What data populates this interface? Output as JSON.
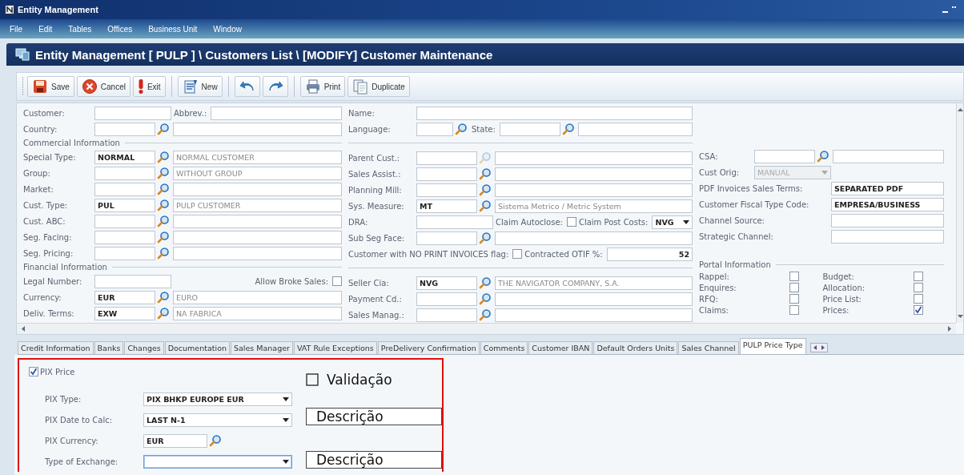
{
  "window": {
    "title": "Entity Management"
  },
  "menu": [
    "File",
    "Edit",
    "Tables",
    "Offices",
    "Business Unit",
    "Window"
  ],
  "page_title": "Entity Management [ PULP ] \\ Customers List \\ [MODIFY] Customer Maintenance",
  "toolbar": [
    {
      "buttons": [
        {
          "kind": "save",
          "label": "Save"
        },
        {
          "kind": "cancel",
          "label": "Cancel"
        },
        {
          "kind": "exit",
          "label": "Exit"
        }
      ]
    },
    {
      "buttons": [
        {
          "kind": "new",
          "label": "New"
        }
      ]
    },
    {
      "buttons": [
        {
          "kind": "undo"
        },
        {
          "kind": "redo"
        }
      ]
    },
    {
      "buttons": [
        {
          "kind": "print",
          "label": "Print"
        },
        {
          "kind": "duplicate",
          "label": "Duplicate"
        }
      ]
    }
  ],
  "form": {
    "columns": [
      {
        "items": [
          {
            "kind": "row",
            "fields": [
              {
                "kind": "text",
                "label": "Customer:"
              },
              {
                "kind": "text",
                "label": "Abbrev.:"
              }
            ]
          },
          {
            "kind": "row",
            "fields": [
              {
                "kind": "lookup_desc",
                "label": "Country:"
              }
            ]
          },
          {
            "kind": "section",
            "title": "Commercial Information"
          },
          {
            "kind": "row",
            "fields": [
              {
                "kind": "lookup_desc",
                "label": "Special Type:",
                "code": "NORMAL",
                "description": "NORMAL CUSTOMER"
              }
            ]
          },
          {
            "kind": "row",
            "fields": [
              {
                "kind": "lookup_desc",
                "label": "Group:",
                "description": "WITHOUT GROUP"
              }
            ]
          },
          {
            "kind": "row",
            "fields": [
              {
                "kind": "lookup_desc",
                "label": "Market:"
              }
            ]
          },
          {
            "kind": "row",
            "fields": [
              {
                "kind": "lookup_desc",
                "label": "Cust. Type:",
                "code": "PUL",
                "description": "PULP CUSTOMER"
              }
            ]
          },
          {
            "kind": "row",
            "fields": [
              {
                "kind": "lookup_desc",
                "label": "Cust. ABC:"
              }
            ]
          },
          {
            "kind": "row",
            "fields": [
              {
                "kind": "lookup_desc",
                "label": "Seg. Facing:"
              }
            ]
          },
          {
            "kind": "row",
            "fields": [
              {
                "kind": "lookup_desc",
                "label": "Seg. Pricing:"
              }
            ]
          },
          {
            "kind": "section",
            "title": "Financial Information"
          },
          {
            "kind": "row",
            "fields": [
              {
                "kind": "text",
                "label": "Legal Number:"
              },
              {
                "kind": "check",
                "label": "Allow Broke Sales:",
                "checked": false
              }
            ]
          },
          {
            "kind": "row",
            "fields": [
              {
                "kind": "lookup_desc",
                "label": "Currency:",
                "code": "EUR",
                "description": "EURO"
              }
            ]
          },
          {
            "kind": "row",
            "fields": [
              {
                "kind": "lookup_desc",
                "label": "Deliv. Terms:",
                "code": "EXW",
                "description": "NA FABRICA"
              }
            ]
          }
        ]
      },
      {
        "items": [
          {
            "kind": "row",
            "fields": [
              {
                "kind": "text",
                "label": "Name:"
              }
            ]
          },
          {
            "kind": "row",
            "fields": [
              {
                "kind": "lookup",
                "label": "Language:"
              },
              {
                "kind": "lookup_desc",
                "label": "State:"
              }
            ]
          },
          {
            "kind": "rule"
          },
          {
            "kind": "row",
            "fields": [
              {
                "kind": "lookup_desc",
                "label": "Parent Cust.:",
                "disabled": true
              }
            ]
          },
          {
            "kind": "row",
            "fields": [
              {
                "kind": "lookup_desc",
                "label": "Sales Assist.:"
              }
            ]
          },
          {
            "kind": "row",
            "fields": [
              {
                "kind": "lookup_desc",
                "label": "Planning Mill:"
              }
            ]
          },
          {
            "kind": "row",
            "fields": [
              {
                "kind": "lookup_desc",
                "label": "Sys. Measure:",
                "code": "MT",
                "description": "Sistema Metrico / Metric System"
              }
            ]
          },
          {
            "kind": "row",
            "fields": [
              {
                "kind": "text",
                "label": "DRA:"
              },
              {
                "kind": "check",
                "label": "Claim Autoclose:",
                "checked": false
              },
              {
                "kind": "combo",
                "label": "Claim Post Costs:",
                "value": "NVG"
              }
            ]
          },
          {
            "kind": "row",
            "fields": [
              {
                "kind": "lookup_desc",
                "label": "Sub Seg Face:"
              }
            ]
          },
          {
            "kind": "row",
            "fields": [
              {
                "kind": "check",
                "label": "Customer with NO PRINT INVOICES flag:",
                "checked": false
              },
              {
                "kind": "number",
                "label": "Contracted OTIF %:",
                "value": "52"
              }
            ]
          },
          {
            "kind": "rule"
          },
          {
            "kind": "row",
            "fields": [
              {
                "kind": "lookup_desc",
                "label": "Seller Cia:",
                "code": "NVG",
                "description": "THE NAVIGATOR COMPANY, S.A."
              }
            ]
          },
          {
            "kind": "row",
            "fields": [
              {
                "kind": "lookup_desc",
                "label": "Payment Cd.:"
              }
            ]
          },
          {
            "kind": "row",
            "fields": [
              {
                "kind": "lookup_desc",
                "label": "Sales Manag.:"
              }
            ]
          }
        ]
      },
      {
        "items": [
          {
            "kind": "row",
            "fields": [
              {
                "kind": "lookup_desc",
                "label": "CSA:"
              }
            ]
          },
          {
            "kind": "row",
            "fields": [
              {
                "kind": "combo",
                "label": "Cust Orig:",
                "value": "MANUAL",
                "disabled": true
              }
            ]
          },
          {
            "kind": "row",
            "fields": [
              {
                "kind": "text",
                "label": "PDF Invoices Sales Terms:",
                "value": "SEPARATED PDF"
              }
            ]
          },
          {
            "kind": "row",
            "fields": [
              {
                "kind": "text",
                "label": "Customer Fiscal Type Code:",
                "value": "EMPRESA/BUSINESS"
              }
            ]
          },
          {
            "kind": "row",
            "fields": [
              {
                "kind": "text",
                "label": "Channel Source:"
              }
            ]
          },
          {
            "kind": "row",
            "fields": [
              {
                "kind": "text",
                "label": "Strategic Channel:"
              }
            ]
          },
          {
            "kind": "section",
            "title": "Portal Information"
          },
          {
            "kind": "compact_row",
            "fields": [
              {
                "kind": "check",
                "label": "Rappel:",
                "checked": false
              },
              {
                "kind": "check",
                "label": "Budget:",
                "checked": false
              }
            ]
          },
          {
            "kind": "compact_row",
            "fields": [
              {
                "kind": "check",
                "label": "Enquires:",
                "checked": false
              },
              {
                "kind": "check",
                "label": "Allocation:",
                "checked": false
              }
            ]
          },
          {
            "kind": "compact_row",
            "fields": [
              {
                "kind": "check",
                "label": "RFQ:",
                "checked": false
              },
              {
                "kind": "check",
                "label": "Price List:",
                "checked": false
              }
            ]
          },
          {
            "kind": "compact_row",
            "fields": [
              {
                "kind": "check",
                "label": "Claims:",
                "checked": false
              },
              {
                "kind": "check",
                "label": "Prices:",
                "checked": true
              }
            ]
          }
        ]
      }
    ]
  },
  "tabs": [
    {
      "label": "Credit Information",
      "selected": false
    },
    {
      "label": "Banks",
      "selected": false
    },
    {
      "label": "Changes",
      "selected": false
    },
    {
      "label": "Documentation",
      "selected": false
    },
    {
      "label": "Sales Manager",
      "selected": false
    },
    {
      "label": "VAT Rule Exceptions",
      "selected": false
    },
    {
      "label": "PreDelivery Confirmation",
      "selected": false
    },
    {
      "label": "Comments",
      "selected": false
    },
    {
      "label": "Customer IBAN",
      "selected": false
    },
    {
      "label": "Default Orders Units",
      "selected": false
    },
    {
      "label": "Sales Channel",
      "selected": false
    },
    {
      "label": "PULP Price Type",
      "selected": true
    }
  ],
  "pulp_price": {
    "pix_price": {
      "label": "PIX Price",
      "checked": true
    },
    "fields": [
      {
        "kind": "combo",
        "label": "PIX Type:",
        "value": "PIX BHKP EUROPE EUR"
      },
      {
        "kind": "combo",
        "label": "PIX Date to Calc:",
        "value": "LAST N-1"
      },
      {
        "kind": "lookup",
        "label": "PIX Currency:",
        "code": "EUR"
      },
      {
        "kind": "combo",
        "label": "Type of Exchange:",
        "focused": true
      }
    ],
    "annotations": {
      "validation": {
        "label": "Validação",
        "checked": false
      },
      "descriptions": [
        "Descrição",
        "Descrição"
      ]
    }
  }
}
